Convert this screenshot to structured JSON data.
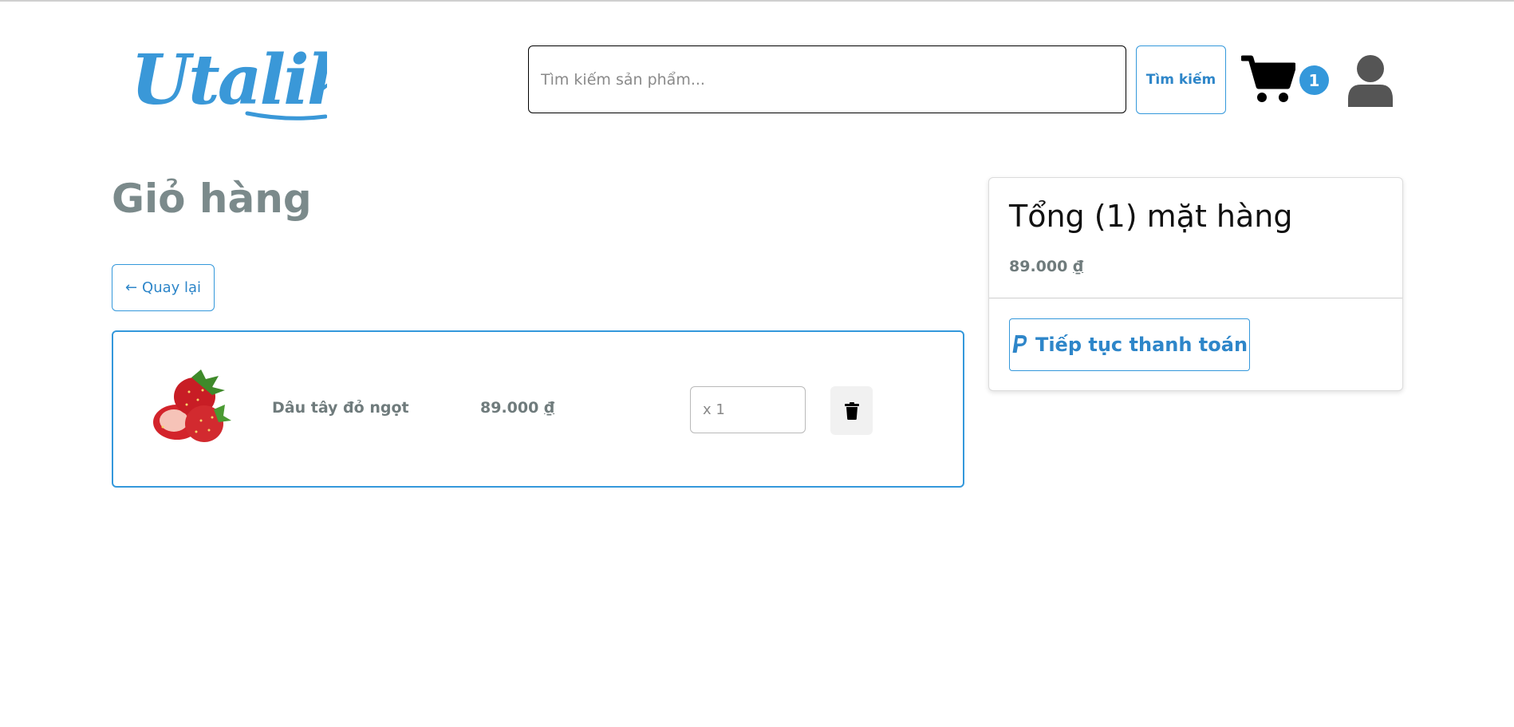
{
  "header": {
    "logo_text": "Utalik",
    "search_placeholder": "Tìm kiếm sản phẩm...",
    "search_button_label": "Tìm kiếm",
    "cart_count": "1",
    "cart_icon": "cart-icon",
    "user_icon": "user-icon"
  },
  "page": {
    "title": "Giỏ hàng",
    "back_label": "Quay lại",
    "back_icon": "arrow-left-icon"
  },
  "cart": {
    "items": [
      {
        "image": "strawberry-image",
        "name": "Dâu tây đỏ ngọt",
        "price": "89.000",
        "currency": "₫",
        "quantity_placeholder": "x 1",
        "delete_icon": "trash-icon"
      }
    ]
  },
  "summary": {
    "title": "Tổng (1) mặt hàng",
    "total": "89.000",
    "currency": "₫",
    "checkout_label": "Tiếp tục thanh toán",
    "checkout_icon": "paypal-icon"
  },
  "colors": {
    "accent": "#3498db",
    "muted_text": "#7b8a8b",
    "icon_dark": "#555555"
  }
}
